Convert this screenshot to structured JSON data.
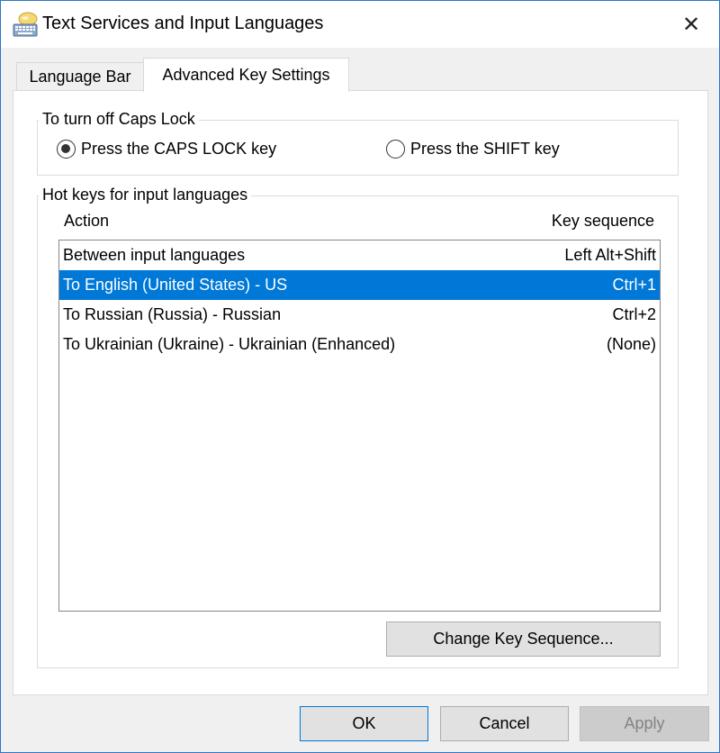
{
  "window": {
    "title": "Text Services and Input Languages",
    "close_glyph": "✕"
  },
  "tabs": [
    {
      "label": "Language Bar",
      "active": false
    },
    {
      "label": "Advanced Key Settings",
      "active": true
    }
  ],
  "caps_lock": {
    "legend": "To turn off Caps Lock",
    "options": [
      {
        "label": "Press the CAPS LOCK key",
        "checked": true
      },
      {
        "label": "Press the SHIFT key",
        "checked": false
      }
    ]
  },
  "hotkeys": {
    "legend": "Hot keys for input languages",
    "columns": {
      "action": "Action",
      "key_sequence": "Key sequence"
    },
    "rows": [
      {
        "action": "Between input languages",
        "key": "Left Alt+Shift",
        "selected": false
      },
      {
        "action": "To English (United States) - US",
        "key": "Ctrl+1",
        "selected": true
      },
      {
        "action": "To Russian (Russia) - Russian",
        "key": "Ctrl+2",
        "selected": false
      },
      {
        "action": "To Ukrainian (Ukraine) - Ukrainian (Enhanced)",
        "key": "(None)",
        "selected": false
      }
    ],
    "change_button": "Change Key Sequence..."
  },
  "footer": {
    "ok": "OK",
    "cancel": "Cancel",
    "apply": "Apply",
    "apply_enabled": false
  },
  "colors": {
    "selection": "#0078d7",
    "window_border": "#2b78c9"
  },
  "icons": {
    "app": "keyboard-language-icon",
    "close": "close-icon"
  }
}
